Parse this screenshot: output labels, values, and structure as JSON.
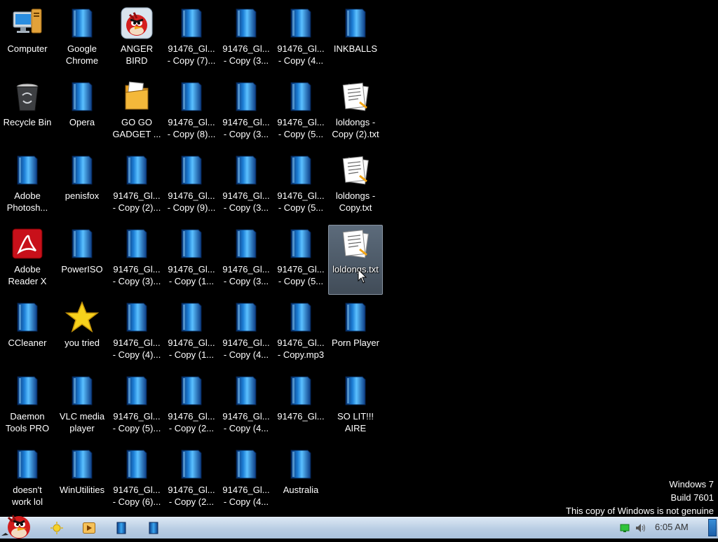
{
  "desktop": {
    "icons": [
      {
        "label": "Computer",
        "type": "computer",
        "col": 0,
        "row": 0
      },
      {
        "label": "Recycle Bin",
        "type": "recycle",
        "col": 0,
        "row": 1
      },
      {
        "label": "Adobe\nPhotosh...",
        "type": "generic",
        "col": 0,
        "row": 2
      },
      {
        "label": "Adobe\nReader X",
        "type": "adobe",
        "col": 0,
        "row": 3
      },
      {
        "label": "CCleaner",
        "type": "generic",
        "col": 0,
        "row": 4
      },
      {
        "label": "Daemon\nTools PRO",
        "type": "generic",
        "col": 0,
        "row": 5
      },
      {
        "label": "doesn't\nwork lol",
        "type": "generic",
        "col": 0,
        "row": 6
      },
      {
        "label": "Google\nChrome",
        "type": "generic",
        "col": 1,
        "row": 0
      },
      {
        "label": "Opera",
        "type": "generic",
        "col": 1,
        "row": 1
      },
      {
        "label": "penisfox",
        "type": "generic",
        "col": 1,
        "row": 2
      },
      {
        "label": "PowerISO",
        "type": "generic",
        "col": 1,
        "row": 3
      },
      {
        "label": "you tried",
        "type": "star",
        "col": 1,
        "row": 4
      },
      {
        "label": "VLC media\nplayer",
        "type": "generic",
        "col": 1,
        "row": 5
      },
      {
        "label": "WinUtilities",
        "type": "generic",
        "col": 1,
        "row": 6
      },
      {
        "label": "ANGER\nBIRD",
        "type": "bird",
        "col": 2,
        "row": 0
      },
      {
        "label": "GO GO\nGADGET ...",
        "type": "folder",
        "col": 2,
        "row": 1
      },
      {
        "label": "91476_Gl...\n- Copy (2)...",
        "type": "generic",
        "col": 2,
        "row": 2
      },
      {
        "label": "91476_Gl...\n- Copy (3)...",
        "type": "generic",
        "col": 2,
        "row": 3
      },
      {
        "label": "91476_Gl...\n- Copy (4)...",
        "type": "generic",
        "col": 2,
        "row": 4
      },
      {
        "label": "91476_Gl...\n- Copy (5)...",
        "type": "generic",
        "col": 2,
        "row": 5
      },
      {
        "label": "91476_Gl...\n- Copy (6)...",
        "type": "generic",
        "col": 2,
        "row": 6
      },
      {
        "label": "91476_Gl...\n- Copy (7)...",
        "type": "generic",
        "col": 3,
        "row": 0
      },
      {
        "label": "91476_Gl...\n- Copy (8)...",
        "type": "generic",
        "col": 3,
        "row": 1
      },
      {
        "label": "91476_Gl...\n- Copy (9)...",
        "type": "generic",
        "col": 3,
        "row": 2
      },
      {
        "label": "91476_Gl...\n- Copy (1...",
        "type": "generic",
        "col": 3,
        "row": 3
      },
      {
        "label": "91476_Gl...\n- Copy (1...",
        "type": "generic",
        "col": 3,
        "row": 4
      },
      {
        "label": "91476_Gl...\n- Copy (2...",
        "type": "generic",
        "col": 3,
        "row": 5
      },
      {
        "label": "91476_Gl...\n- Copy (2...",
        "type": "generic",
        "col": 3,
        "row": 6
      },
      {
        "label": "91476_Gl...\n- Copy (3...",
        "type": "generic",
        "col": 4,
        "row": 0
      },
      {
        "label": "91476_Gl...\n- Copy (3...",
        "type": "generic",
        "col": 4,
        "row": 1
      },
      {
        "label": "91476_Gl...\n- Copy (3...",
        "type": "generic",
        "col": 4,
        "row": 2
      },
      {
        "label": "91476_Gl...\n- Copy (3...",
        "type": "generic",
        "col": 4,
        "row": 3
      },
      {
        "label": "91476_Gl...\n- Copy (4...",
        "type": "generic",
        "col": 4,
        "row": 4
      },
      {
        "label": "91476_Gl...\n- Copy (4...",
        "type": "generic",
        "col": 4,
        "row": 5
      },
      {
        "label": "91476_Gl...\n- Copy (4...",
        "type": "generic",
        "col": 4,
        "row": 6
      },
      {
        "label": "91476_Gl...\n- Copy (4...",
        "type": "generic",
        "col": 5,
        "row": 0
      },
      {
        "label": "91476_Gl...\n- Copy (5...",
        "type": "generic",
        "col": 5,
        "row": 1
      },
      {
        "label": "91476_Gl...\n- Copy (5...",
        "type": "generic",
        "col": 5,
        "row": 2
      },
      {
        "label": "91476_Gl...\n- Copy (5...",
        "type": "generic",
        "col": 5,
        "row": 3
      },
      {
        "label": "91476_Gl...\n- Copy.mp3",
        "type": "generic",
        "col": 5,
        "row": 4
      },
      {
        "label": "91476_Gl...",
        "type": "generic",
        "col": 5,
        "row": 5
      },
      {
        "label": "Australia",
        "type": "generic",
        "col": 5,
        "row": 6
      },
      {
        "label": "INKBALLS",
        "type": "generic",
        "col": 6,
        "row": 0
      },
      {
        "label": "loldongs -\nCopy (2).txt",
        "type": "text",
        "col": 6,
        "row": 1
      },
      {
        "label": "loldongs -\nCopy.txt",
        "type": "text",
        "col": 6,
        "row": 2
      },
      {
        "label": "loldongs.txt",
        "type": "text",
        "col": 6,
        "row": 3,
        "selected": true
      },
      {
        "label": "Porn Player",
        "type": "generic",
        "col": 6,
        "row": 4
      },
      {
        "label": "SO LIT!!!\nAIRE",
        "type": "generic",
        "col": 6,
        "row": 5
      }
    ]
  },
  "watermark": {
    "line1": "Windows 7",
    "line2": "Build 7601",
    "line3": "This copy of Windows is not genuine"
  },
  "taskbar": {
    "clock": "6:05 AM",
    "pinned": [
      "sun-icon",
      "media-player-icon",
      "blue-app-icon",
      "blue-app-icon"
    ]
  },
  "colors": {
    "taskbar_top": "#dbe7f4",
    "taskbar_bottom": "#aac2dd",
    "selection": "#4c5866"
  }
}
